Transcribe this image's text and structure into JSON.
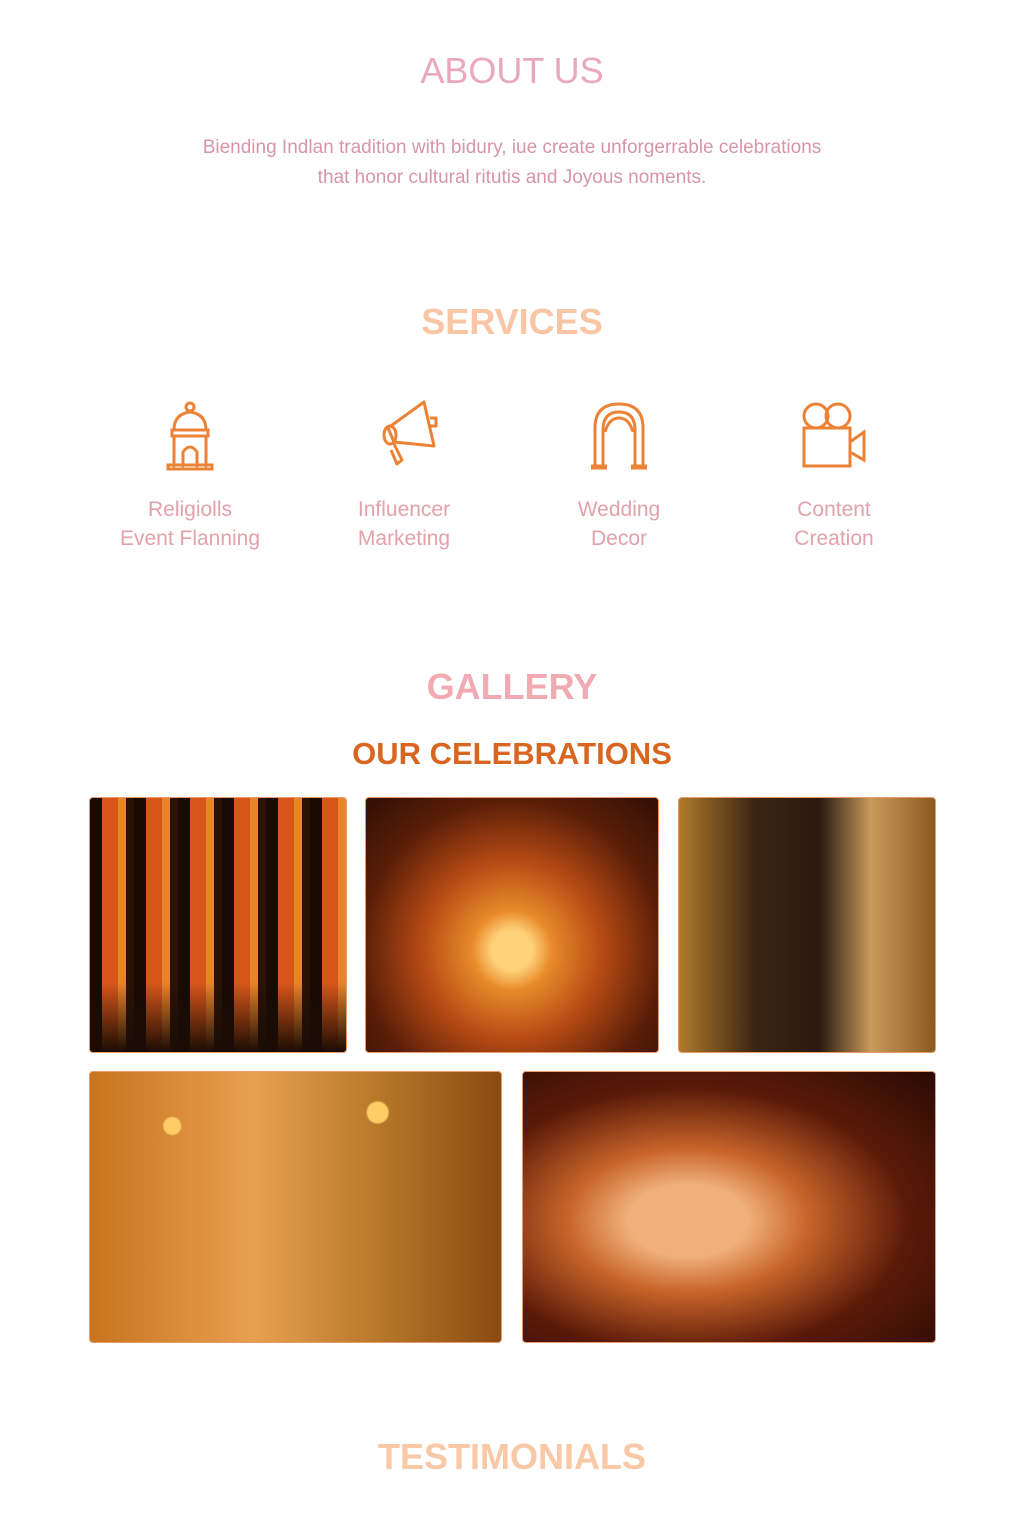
{
  "about": {
    "title": "ABOUT US",
    "text_line1": "Biending Indlan tradition with bidury, iue create unforgerrable celebrations",
    "text_line2": "that honor cultural ritutis and Joyous  noments."
  },
  "services": {
    "title": "SERVICES",
    "items": [
      {
        "icon": "temple-icon",
        "line1": "Religiolls",
        "line2": "Event Flanning"
      },
      {
        "icon": "megaphone-icon",
        "line1": "Influencer",
        "line2": "Marketing"
      },
      {
        "icon": "arch-icon",
        "line1": "Wedding",
        "line2": "Decor"
      },
      {
        "icon": "video-camera-icon",
        "line1": "Content",
        "line2": "Creation"
      }
    ]
  },
  "gallery": {
    "title": "GALLERY",
    "subtitle": "OUR CELEBRATIONS"
  },
  "testimonials": {
    "title": "TESTIMONIALS"
  },
  "colors": {
    "accent": "#ec8236",
    "pink": "#eaa8bc",
    "peach": "#f8c6a4",
    "heading_orange": "#d96620"
  }
}
